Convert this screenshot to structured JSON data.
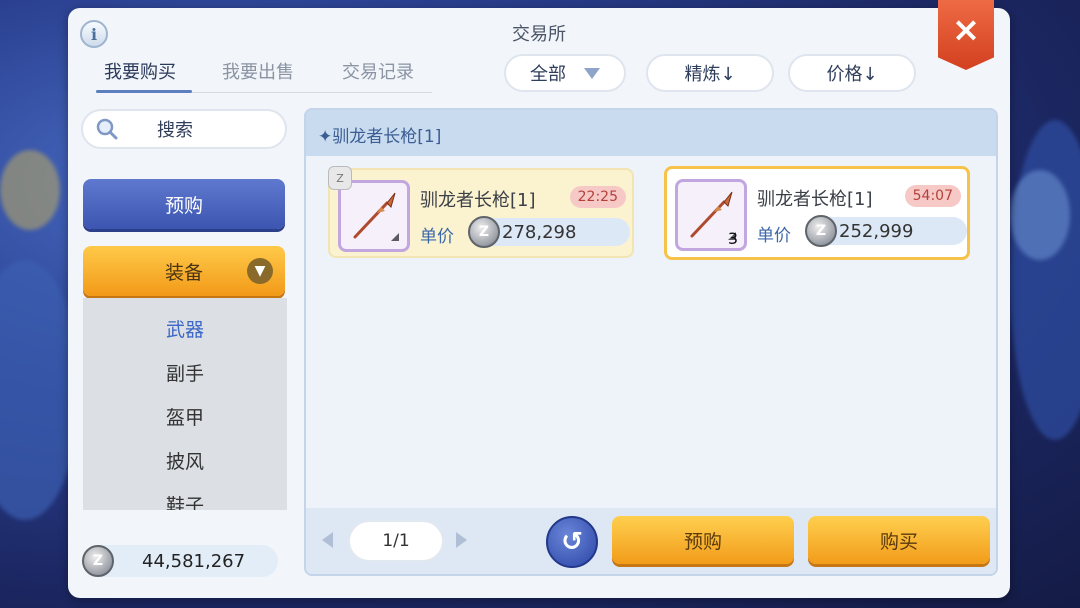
{
  "window": {
    "title": "交易所",
    "close_label": "×",
    "info_label": "i"
  },
  "tabs": [
    {
      "label": "我要购买",
      "active": true
    },
    {
      "label": "我要出售",
      "active": false
    },
    {
      "label": "交易记录",
      "active": false
    }
  ],
  "filters": {
    "category": "全部",
    "refine_sort": "精炼↓",
    "price_sort": "价格↓"
  },
  "sidebar": {
    "search_label": "搜索",
    "preorder_label": "预购",
    "equipment_label": "装备",
    "categories": [
      {
        "label": "武器",
        "active": true
      },
      {
        "label": "副手",
        "active": false
      },
      {
        "label": "盔甲",
        "active": false
      },
      {
        "label": "披风",
        "active": false
      },
      {
        "label": "鞋子",
        "active": false
      }
    ],
    "balance": "44,581,267"
  },
  "content": {
    "title": "✦驯龙者长枪[1]",
    "items": [
      {
        "name": "驯龙者长枪[1]",
        "timer": "22:25",
        "price_label": "单价",
        "price": "278,298",
        "count": "",
        "has_bag_icon": true
      },
      {
        "name": "驯龙者长枪[1]",
        "timer": "54:07",
        "price_label": "单价",
        "price": "252,999",
        "count": "3",
        "has_bag_icon": false
      }
    ],
    "pagination": "1/1",
    "preorder_button": "预购",
    "buy_button": "购买"
  },
  "colors": {
    "accent_blue": "#3c55b0",
    "accent_orange": "#f29a18",
    "close_red": "#d2401f",
    "timer_bg": "#f6c9c6"
  },
  "icons": {
    "info": "info-icon",
    "close": "close-icon",
    "search": "search-icon",
    "dropdown": "triangle-down-icon",
    "zeny": "zeny-coin-icon",
    "refresh": "refresh-icon",
    "spear": "spear-icon"
  }
}
